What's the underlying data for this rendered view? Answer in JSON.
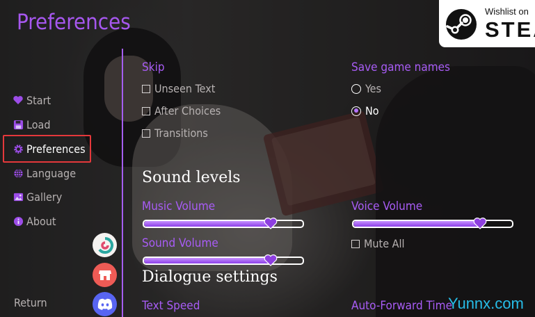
{
  "title": "Preferences",
  "steam": {
    "wishlist_text": "Wishlist on",
    "steam_text": "STEAM",
    "icon": "steam-logo-icon"
  },
  "nav": {
    "items": [
      {
        "label": "Start",
        "icon": "heart-icon"
      },
      {
        "label": "Load",
        "icon": "save-icon"
      },
      {
        "label": "Preferences",
        "icon": "gear-icon",
        "active": true
      },
      {
        "label": "Language",
        "icon": "globe-icon"
      },
      {
        "label": "Gallery",
        "icon": "image-icon"
      },
      {
        "label": "About",
        "icon": "info-icon"
      }
    ],
    "return_label": "Return",
    "social": [
      "itch-io-icon",
      "store-icon",
      "discord-icon"
    ]
  },
  "skip": {
    "label": "Skip",
    "options": [
      {
        "label": "Unseen Text",
        "checked": false
      },
      {
        "label": "After Choices",
        "checked": false
      },
      {
        "label": "Transitions",
        "checked": false
      }
    ]
  },
  "save_game_names": {
    "label": "Save game names",
    "options": [
      {
        "label": "Yes",
        "selected": false
      },
      {
        "label": "No",
        "selected": true
      }
    ]
  },
  "sound": {
    "heading": "Sound levels",
    "music": {
      "label": "Music Volume",
      "level": 0.8
    },
    "voice": {
      "label": "Voice Volume",
      "level": 0.8
    },
    "sound": {
      "label": "Sound Volume",
      "level": 0.8
    },
    "mute_all": {
      "label": "Mute All",
      "checked": false
    }
  },
  "dialogue": {
    "heading": "Dialogue settings",
    "text_speed_label": "Text Speed",
    "auto_forward_label": "Auto-Forward Time"
  },
  "watermark": "Yunnx.com",
  "colors": {
    "accent": "#a657ee",
    "highlight_border": "#e5383b",
    "slider_fill": "#a35af0"
  }
}
